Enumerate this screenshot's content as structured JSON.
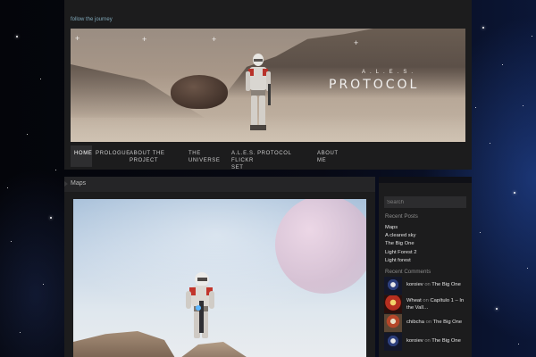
{
  "site": {
    "tagline": "follow the journey",
    "banner_sub": "A.L.E.S.",
    "banner_title": "PROTOCOL"
  },
  "nav": {
    "items": [
      {
        "label": "HOME",
        "active": true
      },
      {
        "label": "PROLOGUE"
      },
      {
        "label": "ABOUT THE\nPROJECT"
      },
      {
        "label": "THE\nUNIVERSE"
      },
      {
        "label": "A.L.E.S. PROTOCOL FLICKR\nSET"
      },
      {
        "label": "ABOUT\nME"
      }
    ]
  },
  "post": {
    "title": "Maps"
  },
  "sidebar": {
    "search_placeholder": "Search",
    "recent_posts_title": "Recent Posts",
    "recent_posts": [
      "Maps",
      "A cleared sky",
      "The Big One",
      "Light Forest 2",
      "Light forest"
    ],
    "recent_comments_title": "Recent Comments",
    "comments": [
      {
        "author": "koroiev",
        "on": "on",
        "post": "The Big One"
      },
      {
        "author": "Wheat",
        "on": "on",
        "post": "Capítulo 1 – In the Vall…"
      },
      {
        "author": "chibcha",
        "on": "on",
        "post": "The Big One"
      },
      {
        "author": "koroiev",
        "on": "on",
        "post": "The Big One"
      }
    ]
  },
  "colors": {
    "header_bg": "#1c1c1d",
    "tagline": "#7fa7b8",
    "nav_active_bg": "#2e2e30",
    "space_accent": "#0b1636"
  }
}
